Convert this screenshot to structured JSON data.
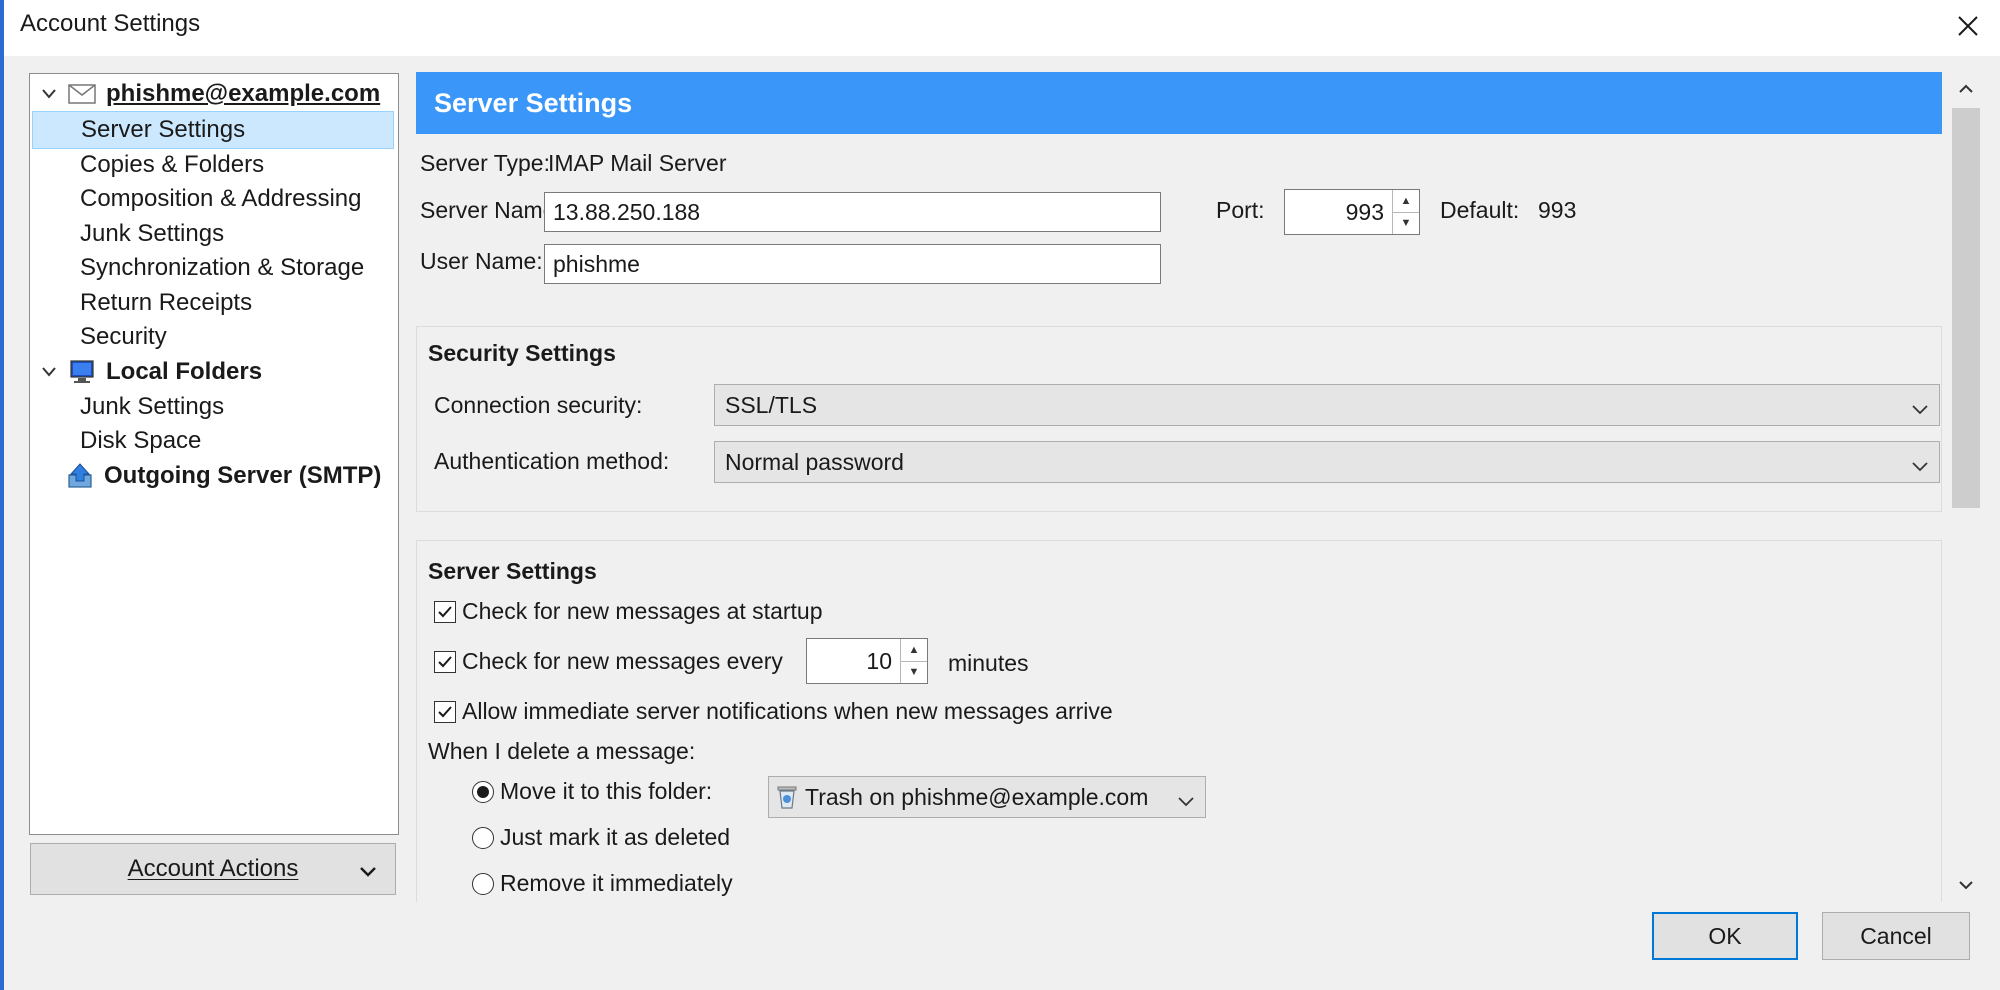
{
  "window": {
    "title": "Account Settings",
    "close_icon": "close-icon"
  },
  "sidebar": {
    "account_email": "phishme@example.com",
    "account_items": [
      "Server Settings",
      "Copies & Folders",
      "Composition & Addressing",
      "Junk Settings",
      "Synchronization & Storage",
      "Return Receipts",
      "Security"
    ],
    "selected_item": "Server Settings",
    "local_folders": "Local Folders",
    "local_items": [
      "Junk Settings",
      "Disk Space"
    ],
    "outgoing_server": "Outgoing Server (SMTP)",
    "account_actions": "Account Actions"
  },
  "main": {
    "header": "Server Settings",
    "server_type_label": "Server Type:",
    "server_type_value": "IMAP Mail Server",
    "server_name_label": "Server Name:",
    "server_name_value": "13.88.250.188",
    "port_label": "Port:",
    "port_value": "993",
    "default_label": "Default:",
    "default_value": "993",
    "user_name_label": "User Name:",
    "user_name_value": "phishme",
    "security": {
      "title": "Security Settings",
      "connection_label": "Connection security:",
      "connection_value": "SSL/TLS",
      "auth_label": "Authentication method:",
      "auth_value": "Normal password"
    },
    "server_settings": {
      "title": "Server Settings",
      "check_startup": "Check for new messages at startup",
      "check_startup_checked": true,
      "check_every": "Check for new messages every",
      "check_every_checked": true,
      "check_every_value": "10",
      "minutes": "minutes",
      "allow_notifications": "Allow immediate server notifications when new messages arrive",
      "allow_notifications_checked": true,
      "delete_label": "When I delete a message:",
      "move_folder": "Move it to this folder:",
      "move_folder_selected": true,
      "trash_folder": "Trash on phishme@example.com",
      "mark_deleted": "Just mark it as deleted",
      "remove_immediately": "Remove it immediately"
    }
  },
  "buttons": {
    "ok": "OK",
    "cancel": "Cancel"
  },
  "colors": {
    "header_bg": "#3a96f8",
    "selection_bg": "#cce8ff",
    "default_button_border": "#0078d7"
  }
}
